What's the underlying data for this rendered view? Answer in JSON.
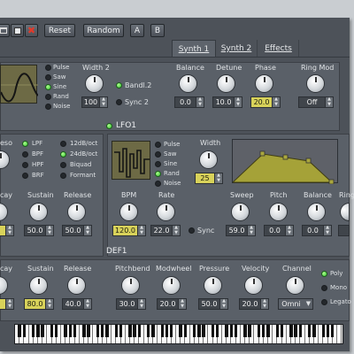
{
  "toolbar": {
    "reset_label": "Reset",
    "random_label": "Random",
    "a_label": "A",
    "b_label": "B"
  },
  "tabs": [
    {
      "label": "Synth 1"
    },
    {
      "label": "Synth 2"
    },
    {
      "label": "Effects"
    }
  ],
  "osc": {
    "waves": [
      "Pulse",
      "Saw",
      "Sine",
      "Rand",
      "Noise"
    ],
    "width2_label": "Width 2",
    "width2_value": "100",
    "band_label": "Bandl.2",
    "sync_label": "Sync 2",
    "balance_label": "Balance",
    "balance_value": "0.0",
    "detune_label": "Detune",
    "detune_value": "10.0",
    "phase_label": "Phase",
    "phase_value": "20.0",
    "ringmod_label": "Ring Mod",
    "ringmod_value": "Off"
  },
  "filter": {
    "reso_label": "eso",
    "types_a": [
      "LPF",
      "BPF",
      "HPF",
      "BRF"
    ],
    "types_b": [
      "12dB/oct",
      "24dB/oct",
      "Biquad",
      "Formant"
    ],
    "decay_label": "cay",
    "sustain_label": "Sustain",
    "sustain_value": "50.0",
    "release_label": "Release",
    "release_value": "50.0"
  },
  "lfo1": {
    "title": "LFO1",
    "waves": [
      "Pulse",
      "Saw",
      "Sine",
      "Rand",
      "Noise"
    ],
    "width_label": "Width",
    "width_value": "25",
    "bpm_label": "BPM",
    "bpm_value": "120.0",
    "rate_label": "Rate",
    "rate_value": "22.0",
    "sync_label": "Sync",
    "sweep_label": "Sweep",
    "sweep_value": "59.0",
    "pitch_label": "Pitch",
    "pitch_value": "0.0",
    "balance_label": "Balance",
    "balance_value": "0.0",
    "ring_label": "Ring"
  },
  "def1": {
    "title": "DEF1",
    "decay_label": "cay",
    "sustain_label": "Sustain",
    "sustain_value": "80.0",
    "release_label": "Release",
    "release_value": "40.0",
    "pitchbend_label": "Pitchbend",
    "pitchbend_value": "30.0",
    "modwheel_label": "Modwheel",
    "modwheel_value": "20.0",
    "pressure_label": "Pressure",
    "pressure_value": "50.0",
    "velocity_label": "Velocity",
    "velocity_value": "20.0",
    "channel_label": "Channel",
    "channel_value": "Omni",
    "modes": [
      "Poly",
      "Mono",
      "Legato"
    ]
  },
  "colors": {
    "accent": "#d8d25a",
    "led_on": "#2fc12c",
    "panel": "#5a6068",
    "bg": "#4d5259"
  },
  "icons": [
    "open-icon",
    "save-icon",
    "close-icon"
  ]
}
